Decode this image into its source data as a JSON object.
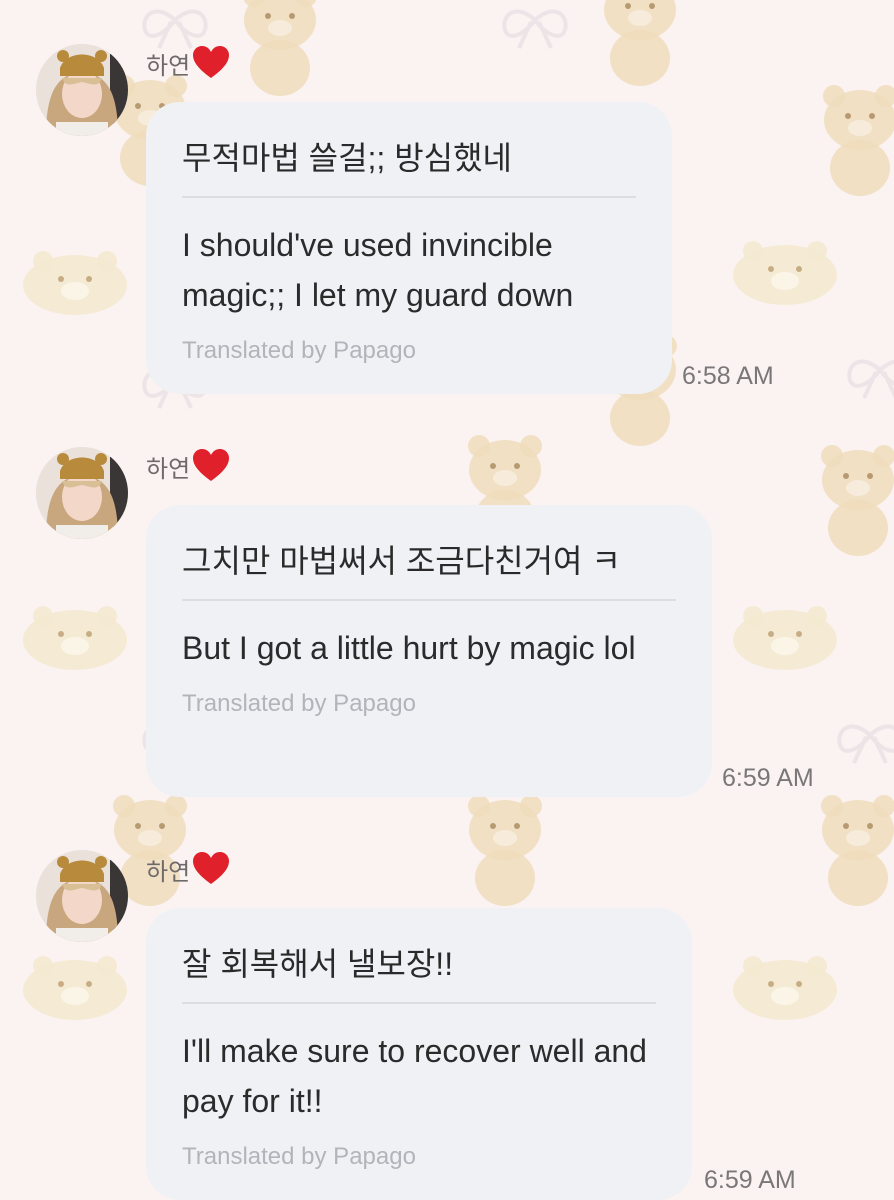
{
  "chat": {
    "messages": [
      {
        "sender": "하연",
        "original_text": "무적마법 쓸걸;; 방심했네",
        "translated_text": "I should've used invincible magic;; I let my guard down",
        "translation_credit": "Translated by Papago",
        "time": "6:58 AM"
      },
      {
        "sender": "하연",
        "original_text": "그치만 마법써서 조금다친거여 ㅋ",
        "translated_text": "But I got a little hurt by magic lol",
        "translation_credit": "Translated by Papago",
        "time": "6:59 AM"
      },
      {
        "sender": "하연",
        "original_text": "잘 회복해서 낼보장!!",
        "translated_text": "I'll make sure to recover well and pay for it!!",
        "translation_credit": "Translated by Papago",
        "time": "6:59 AM"
      }
    ]
  },
  "icons": {
    "sender_heart": "heart-icon",
    "avatar": "avatar"
  },
  "colors": {
    "background": "#fbf3f2",
    "bubble": "#f0f1f5",
    "heart": "#e0202b",
    "credit_text": "#b3b4bb"
  }
}
